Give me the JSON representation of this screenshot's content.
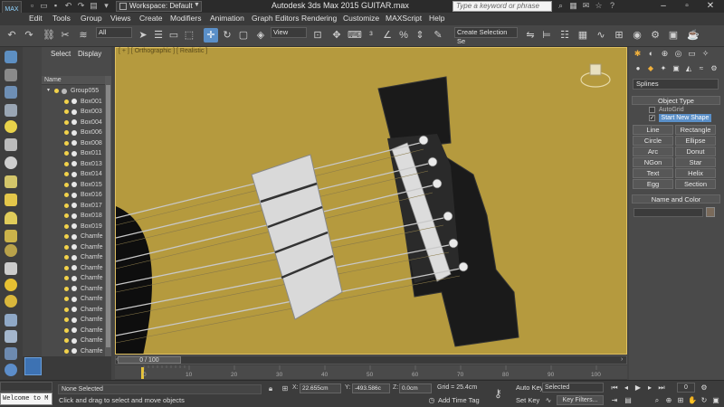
{
  "app": {
    "logo_text": "MAX",
    "workspace_label": "Workspace: Default",
    "window_title": "Autodesk 3ds Max  2015     GUITAR.max",
    "search_placeholder": "Type a keyword or phrase"
  },
  "menu": {
    "items": [
      "Edit",
      "Tools",
      "Group",
      "Views",
      "Create",
      "Modifiers",
      "Animation",
      "Graph Editors",
      "Rendering",
      "Customize",
      "MAXScript",
      "Help"
    ]
  },
  "toolbar": {
    "selection_filter": "All",
    "reference_coord": "View",
    "named_selection": "Create Selection Se"
  },
  "explorer": {
    "tabs": [
      "Select",
      "Display"
    ],
    "column_header": "Name",
    "group": "Group055",
    "items": [
      "Box001",
      "Box003",
      "Box004",
      "Box006",
      "Box008",
      "Box011",
      "Box013",
      "Box014",
      "Box015",
      "Box016",
      "Box017",
      "Box018",
      "Box019",
      "Chamfe",
      "Chamfe",
      "Chamfe",
      "Chamfe",
      "Chamfe",
      "Chamfe",
      "Chamfe",
      "Chamfe",
      "Chamfe",
      "Chamfe",
      "Chamfe",
      "Chamfe"
    ]
  },
  "viewport": {
    "label": "[ + ] [ Orthographic ] [ Realistic ]",
    "background_color": "#b59a3e"
  },
  "command_panel": {
    "category": "Splines",
    "object_type_title": "Object Type",
    "autogrid_label": "AutoGrid",
    "start_new_shape_label": "Start New Shape",
    "start_new_shape_checked": true,
    "buttons": [
      "Line",
      "Rectangle",
      "Circle",
      "Ellipse",
      "Arc",
      "Donut",
      "NGon",
      "Star",
      "Text",
      "Helix",
      "Egg",
      "Section"
    ],
    "name_color_title": "Name and Color"
  },
  "timeline": {
    "slider_label": "0 / 100",
    "ticks": [
      "0",
      "10",
      "20",
      "30",
      "40",
      "50",
      "60",
      "70",
      "80",
      "90",
      "100"
    ]
  },
  "status": {
    "maxscript_text": "Welcome to M",
    "selection_text": "None Selected",
    "prompt": "Click and drag to select and move objects",
    "x_label": "X:",
    "x_value": "22.655cm",
    "y_label": "Y:",
    "y_value": "-493.586c",
    "z_label": "Z:",
    "z_value": "0.0cm",
    "grid_text": "Grid = 25.4cm",
    "add_time_tag": "Add Time Tag",
    "auto_key": "Auto Key",
    "set_key": "Set Key",
    "key_mode": "Selected",
    "key_filters": "Key Filters...",
    "current_frame": "0"
  },
  "colors": {
    "accent": "#5a8fc8",
    "viewport_border": "#e0c060"
  }
}
